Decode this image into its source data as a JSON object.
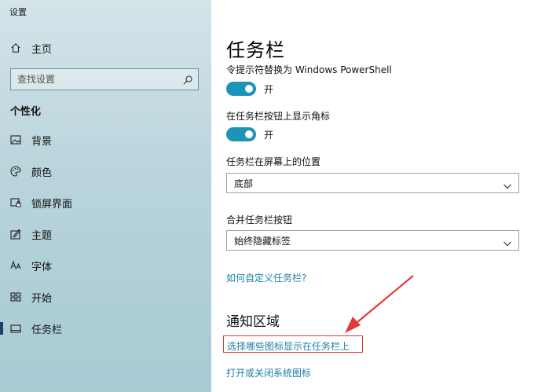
{
  "window": {
    "title": "设置"
  },
  "sidebar": {
    "home_label": "主页",
    "search_placeholder": "查找设置",
    "section_title": "个性化",
    "items": [
      {
        "label": "背景",
        "icon": "image-icon"
      },
      {
        "label": "颜色",
        "icon": "palette-icon"
      },
      {
        "label": "锁屏界面",
        "icon": "lock-screen-icon"
      },
      {
        "label": "主题",
        "icon": "theme-icon"
      },
      {
        "label": "字体",
        "icon": "font-icon"
      },
      {
        "label": "开始",
        "icon": "start-icon"
      },
      {
        "label": "任务栏",
        "icon": "taskbar-icon",
        "active": true
      }
    ]
  },
  "main": {
    "title": "任务栏",
    "settings": [
      {
        "label": "令提示符替换为 Windows PowerShell",
        "state": "开"
      },
      {
        "label": "在任务栏按钮上显示角标",
        "state": "开"
      }
    ],
    "position": {
      "label": "任务栏在屏幕上的位置",
      "value": "底部"
    },
    "combine": {
      "label": "合并任务栏按钮",
      "value": "始终隐藏标签"
    },
    "customize_link": "如何自定义任务栏?",
    "notification_heading": "通知区域",
    "notification_links": {
      "select_icons": "选择哪些图标显示在任务栏上",
      "system_icons": "打开或关闭系统图标"
    }
  },
  "colors": {
    "accent": "#1d93b8",
    "link": "#1d7fa8",
    "highlight": "#e23b3b"
  }
}
